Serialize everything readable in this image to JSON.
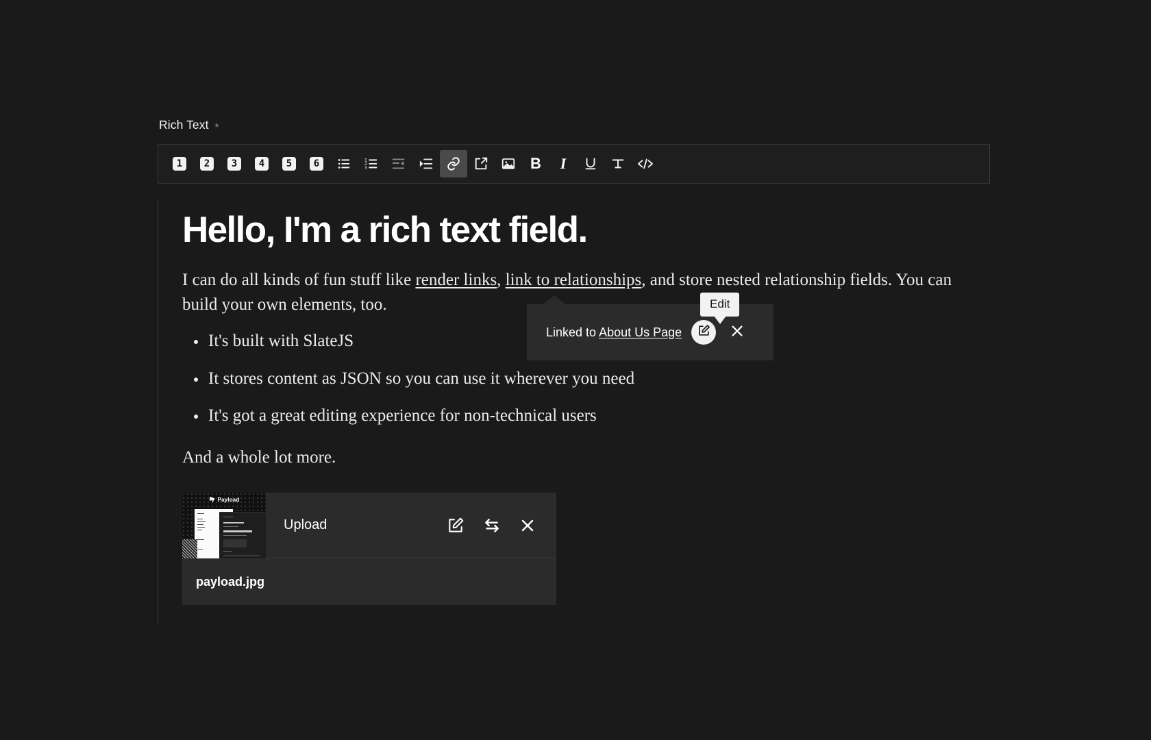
{
  "field": {
    "label": "Rich Text",
    "required_marker": "*"
  },
  "toolbar": {
    "headings": [
      {
        "name": "h1",
        "label": "1"
      },
      {
        "name": "h2",
        "label": "2"
      },
      {
        "name": "h3",
        "label": "3"
      },
      {
        "name": "h4",
        "label": "4"
      },
      {
        "name": "h5",
        "label": "5"
      },
      {
        "name": "h6",
        "label": "6"
      }
    ],
    "icons": [
      {
        "name": "bullet-list-icon",
        "title": "Bullet List"
      },
      {
        "name": "ordered-list-icon",
        "title": "Ordered List"
      },
      {
        "name": "indent-decrease-icon",
        "title": "Indent Left"
      },
      {
        "name": "indent-increase-icon",
        "title": "Indent Right"
      },
      {
        "name": "link-icon",
        "title": "Link",
        "active": true
      },
      {
        "name": "external-link-icon",
        "title": "Relationship"
      },
      {
        "name": "image-icon",
        "title": "Upload"
      },
      {
        "name": "bold-icon",
        "title": "Bold",
        "label": "B"
      },
      {
        "name": "italic-icon",
        "title": "Italic",
        "label": "I"
      },
      {
        "name": "underline-icon",
        "title": "Underline",
        "label": "U"
      },
      {
        "name": "strikethrough-icon",
        "title": "Strikethrough"
      },
      {
        "name": "code-icon",
        "title": "Code"
      }
    ]
  },
  "content": {
    "heading": "Hello, I'm a rich text field.",
    "paragraph1": {
      "before": "I can do all kinds of fun stuff like ",
      "link1": "render links",
      "mid": ", ",
      "link2": "link to relationships",
      "after": ", and store nested relationship fields. You can build your own elements, too."
    },
    "bullets": [
      "It's built with SlateJS",
      "It stores content as JSON so you can use it wherever you need",
      "It's got a great editing experience for non-technical users"
    ],
    "closing": "And a whole lot more."
  },
  "link_popup": {
    "prefix": "Linked to ",
    "target": "About Us Page",
    "edit_icon": "edit-square-icon",
    "close_icon": "close-icon"
  },
  "tooltip": {
    "text": "Edit"
  },
  "upload": {
    "label": "Upload",
    "filename": "payload.jpg",
    "thumbnail_brand": "Payload",
    "actions": [
      {
        "name": "edit-upload-icon",
        "title": "Edit"
      },
      {
        "name": "swap-upload-icon",
        "title": "Swap"
      },
      {
        "name": "remove-upload-icon",
        "title": "Remove"
      }
    ]
  },
  "colors": {
    "background": "#1a1a1a",
    "panel": "#2b2b2b",
    "border": "#3a3a3a",
    "text": "#ececec",
    "accent": "#f2f2f2"
  }
}
